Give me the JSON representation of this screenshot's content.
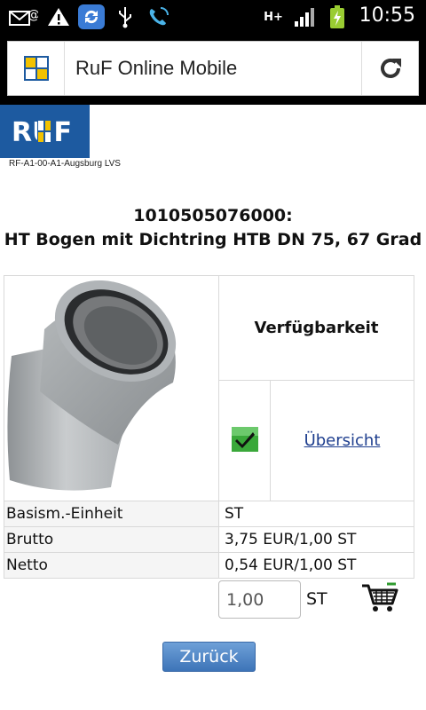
{
  "statusbar": {
    "time": "10:55",
    "icons": [
      "email-alert-icon",
      "warning-icon",
      "sync-icon",
      "usb-icon",
      "phone-call-icon",
      "h-plus-network-icon",
      "signal-icon",
      "battery-charging-icon"
    ],
    "network_label": "H+"
  },
  "browser": {
    "title": "RuF Online Mobile",
    "favicon": "ruf-favicon-icon",
    "refresh": "refresh-icon"
  },
  "logo": {
    "text": "RUF",
    "caption": "RF-A1-00-A1-Augsburg LVS"
  },
  "product": {
    "number": "1010505076000:",
    "name": "HT Bogen mit Dichtring HTB DN 75, 67 Grad",
    "image": "pipe-bend-image"
  },
  "availability": {
    "heading": "Verfügbarkeit",
    "status_icon": "check-icon",
    "link": "Übersicht"
  },
  "rows": [
    {
      "label": "Basism.-Einheit",
      "value": "ST"
    },
    {
      "label": "Brutto",
      "value": "3,75 EUR/1,00 ST"
    },
    {
      "label": "Netto",
      "value": "0,54 EUR/1,00 ST"
    }
  ],
  "order": {
    "quantity": "1,00",
    "unit": "ST",
    "cart_icon": "shopping-cart-icon"
  },
  "back_button": "Zurück",
  "colors": {
    "brand_blue": "#1d5aa0",
    "link_blue": "#1f3f8f",
    "check_green": "#2e9a2e"
  }
}
